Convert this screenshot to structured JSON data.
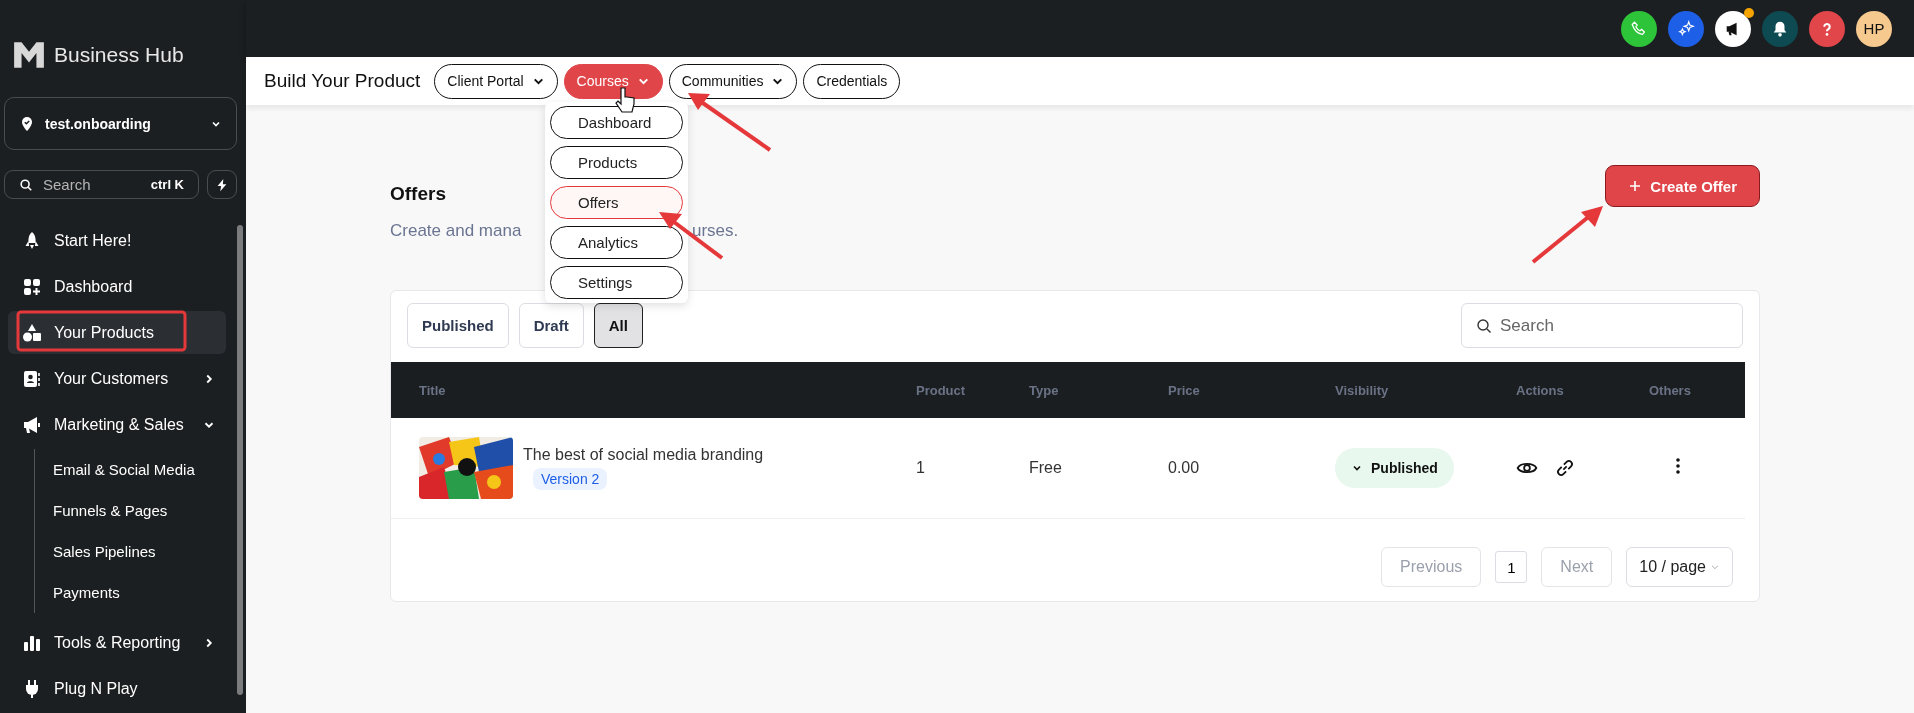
{
  "sidebar": {
    "brand": "Business Hub",
    "workspace": "test.onboarding",
    "search": {
      "placeholder": "Search",
      "shortcut": "ctrl K"
    },
    "items": [
      {
        "label": "Start Here!",
        "selected": false
      },
      {
        "label": "Dashboard",
        "selected": false
      },
      {
        "label": "Your Products",
        "selected": true
      },
      {
        "label": "Your Customers",
        "selected": false,
        "expanded": false
      },
      {
        "label": "Marketing & Sales",
        "selected": false,
        "expanded": true,
        "children": [
          {
            "label": "Email & Social Media",
            "selected": false
          },
          {
            "label": "Funnels & Pages",
            "selected": false
          },
          {
            "label": "Sales Pipelines",
            "selected": false
          },
          {
            "label": "Payments",
            "selected": false
          }
        ]
      },
      {
        "label": "Tools & Reporting",
        "selected": false,
        "expanded": false
      },
      {
        "label": "Plug N Play",
        "selected": false
      }
    ]
  },
  "top_bar": {
    "announcement_badge": true,
    "avatar_initials": "HP"
  },
  "nav": {
    "title": "Build Your Product",
    "tabs": [
      {
        "label": "Client Portal",
        "selected": false,
        "has_menu": true
      },
      {
        "label": "Courses",
        "selected": true,
        "has_menu": true
      },
      {
        "label": "Communities",
        "selected": false,
        "has_menu": true
      },
      {
        "label": "Credentials",
        "selected": false,
        "has_menu": false
      }
    ],
    "menu": [
      {
        "label": "Dashboard",
        "selected": false
      },
      {
        "label": "Products",
        "selected": false
      },
      {
        "label": "Offers",
        "selected": true
      },
      {
        "label": "Analytics",
        "selected": false
      },
      {
        "label": "Settings",
        "selected": false
      }
    ]
  },
  "page": {
    "title": "Offers",
    "subtitle_parts": [
      "Create and mana",
      "urses."
    ],
    "create_button": "Create Offer"
  },
  "filters": [
    {
      "label": "Published",
      "selected": false
    },
    {
      "label": "Draft",
      "selected": false
    },
    {
      "label": "All",
      "selected": true
    }
  ],
  "search": {
    "placeholder": "Search"
  },
  "table": {
    "columns": [
      "Title",
      "Product",
      "Type",
      "Price",
      "Visibility",
      "Actions",
      "Others"
    ],
    "rows": [
      {
        "title": "The best of social media branding",
        "version": "Version 2",
        "product": "1",
        "type": "Free",
        "price": "0.00",
        "visibility": "Published"
      }
    ]
  },
  "pagination": {
    "previous": {
      "label": "Previous",
      "disabled": true
    },
    "page": "1",
    "next": {
      "label": "Next",
      "disabled": true
    },
    "page_size": "10 / page"
  }
}
